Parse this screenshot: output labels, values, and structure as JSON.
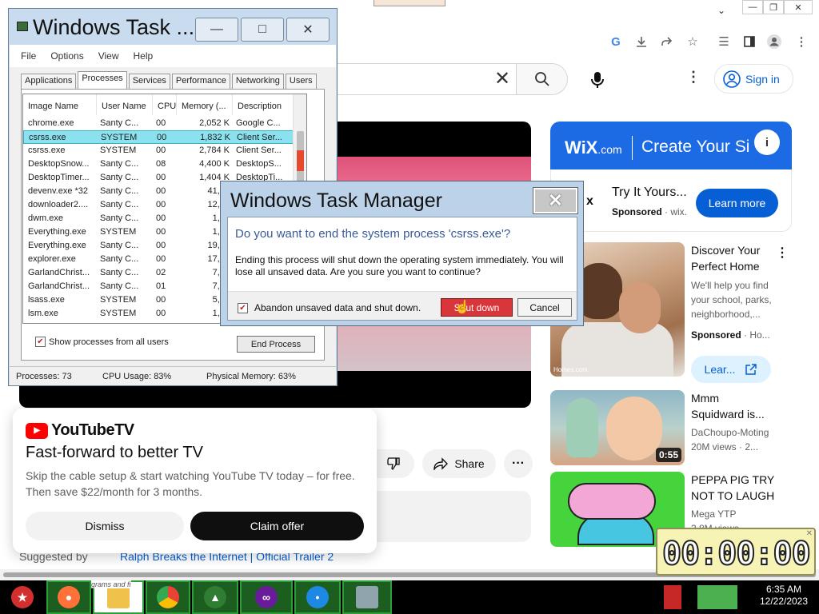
{
  "chrome": {
    "window_controls": [
      "—",
      "❐",
      "✕"
    ],
    "toolbar_icons": [
      "google-icon",
      "download-icon",
      "share-icon",
      "bookmark-star-icon",
      "media-icon",
      "sidebar-icon",
      "profile-icon",
      "menu-icon"
    ]
  },
  "youtube": {
    "search_clear": "✕",
    "sign_in": "Sign in",
    "actions": {
      "share": "Share",
      "more": "···"
    },
    "suggested_label": "Suggested by",
    "suggested_link": "Ralph Breaks the Internet | Official Trailer 2",
    "wix_ad": {
      "logo": "WiX",
      "logo_suffix": ".com",
      "title": "Create Your Si",
      "x": "x",
      "headline": "Try It Yours...",
      "sponsored": "Sponsored",
      "domain": "· wix.",
      "cta": "Learn more"
    },
    "sidebar": [
      {
        "title1": "Discover Your",
        "title2": "Perfect Home",
        "meta1": "We'll help you find",
        "meta2": "your school, parks,",
        "meta3": "neighborhood,...",
        "sponsored": "Sponsored",
        "domain": "· Ho...",
        "cta": "Lear...",
        "tag": "Homes.com"
      },
      {
        "title1": "Mmm",
        "title2": "Squidward is...",
        "meta1": "DaChoupo-Moting",
        "meta2": "20M views · 2...",
        "duration": "0:55"
      },
      {
        "title1": "PEPPA PIG TRY",
        "title2": "NOT TO LAUGH",
        "meta1": "Mega YTP",
        "meta2": "3.8M views · ..."
      }
    ],
    "yttv": {
      "brand": "YouTubeTV",
      "headline": "Fast-forward to better TV",
      "body1": "Skip the cable setup & start watching YouTube TV today – for free.",
      "body2": "Then save $22/month for 3 months.",
      "dismiss": "Dismiss",
      "claim": "Claim offer"
    }
  },
  "taskmgr": {
    "title": "Windows Task ...",
    "menu": [
      "File",
      "Options",
      "View",
      "Help"
    ],
    "tabs": [
      "Applications",
      "Processes",
      "Services",
      "Performance",
      "Networking",
      "Users"
    ],
    "active_tab": "Processes",
    "columns": [
      "Image Name",
      "User Name",
      "CPU",
      "Memory (...",
      "Description"
    ],
    "rows": [
      {
        "name": "chrome.exe",
        "user": "Santy C...",
        "cpu": "00",
        "mem": "2,052 K",
        "desc": "Google C..."
      },
      {
        "name": "csrss.exe",
        "user": "SYSTEM",
        "cpu": "00",
        "mem": "1,832 K",
        "desc": "Client Ser..."
      },
      {
        "name": "csrss.exe",
        "user": "SYSTEM",
        "cpu": "00",
        "mem": "2,784 K",
        "desc": "Client Ser..."
      },
      {
        "name": "DesktopSnow...",
        "user": "Santy C...",
        "cpu": "08",
        "mem": "4,400 K",
        "desc": "DesktopS..."
      },
      {
        "name": "DesktopTimer...",
        "user": "Santy C...",
        "cpu": "00",
        "mem": "1,404 K",
        "desc": "DesktopTi..."
      },
      {
        "name": "devenv.exe *32",
        "user": "Santy C...",
        "cpu": "00",
        "mem": "41,72",
        "desc": ""
      },
      {
        "name": "downloader2....",
        "user": "Santy C...",
        "cpu": "00",
        "mem": "12,93",
        "desc": ""
      },
      {
        "name": "dwm.exe",
        "user": "Santy C...",
        "cpu": "00",
        "mem": "1,71",
        "desc": ""
      },
      {
        "name": "Everything.exe",
        "user": "SYSTEM",
        "cpu": "00",
        "mem": "1,82",
        "desc": ""
      },
      {
        "name": "Everything.exe",
        "user": "Santy C...",
        "cpu": "00",
        "mem": "19,47",
        "desc": ""
      },
      {
        "name": "explorer.exe",
        "user": "Santy C...",
        "cpu": "00",
        "mem": "17,72",
        "desc": ""
      },
      {
        "name": "GarlandChrist...",
        "user": "Santy C...",
        "cpu": "02",
        "mem": "7,57",
        "desc": ""
      },
      {
        "name": "GarlandChrist...",
        "user": "Santy C...",
        "cpu": "01",
        "mem": "7,80",
        "desc": ""
      },
      {
        "name": "lsass.exe",
        "user": "SYSTEM",
        "cpu": "00",
        "mem": "5,88",
        "desc": ""
      },
      {
        "name": "lsm.exe",
        "user": "SYSTEM",
        "cpu": "00",
        "mem": "1,84",
        "desc": ""
      }
    ],
    "show_all": "Show processes from all users",
    "end_process": "End Process",
    "status": {
      "processes": "Processes: 73",
      "cpu": "CPU Usage: 83%",
      "memory": "Physical Memory: 63%"
    }
  },
  "dialog": {
    "title": "Windows Task Manager",
    "question": "Do you want to end the system process 'csrss.exe'?",
    "explain": "Ending this process will shut down the operating system immediately.  You will lose all unsaved data.  Are you sure you want to continue?",
    "abandon": "Abandon unsaved data and shut down.",
    "shutdown": "Shut down",
    "cancel": "Cancel"
  },
  "timer": {
    "value": "00:00:00"
  },
  "taskbar": {
    "caption": "grams and fi",
    "clock_time": "6:35 AM",
    "clock_date": "12/22/2023"
  }
}
